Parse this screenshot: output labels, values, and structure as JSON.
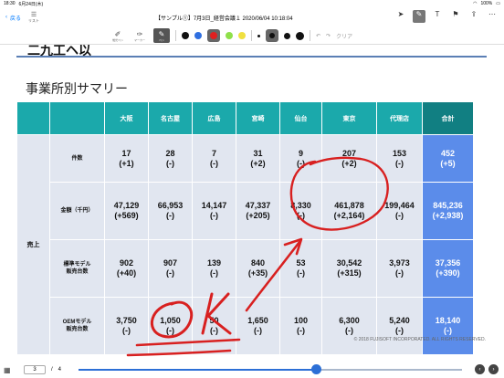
{
  "status": {
    "time": "18:30",
    "date": "6月24日(木)",
    "battery": "100%"
  },
  "nav": {
    "back_label": "戻る",
    "list_label": "リスト",
    "title": "【サンプル①】7月3日_経営会議１ 2020/06/04 10:18:04"
  },
  "toolbar": {
    "highlighter_label": "蛍光ペン",
    "marker_label": "マーカー",
    "pen_label": "ペン",
    "clear_label": "クリア",
    "colors": [
      "#111111",
      "#2f6fe0",
      "#e02020",
      "#8fe04a",
      "#f0e040"
    ]
  },
  "page": {
    "header_text": "二九工ヘ以",
    "subtitle": "事業所別サマリー",
    "copyright": "© 2018 FUJISOFT INCORPORATED. ALL RIGHTS RESERVED."
  },
  "table": {
    "headers": [
      "大阪",
      "名古屋",
      "広島",
      "宮崎",
      "仙台",
      "東京",
      "代理店",
      "合計"
    ],
    "group_label": "売上",
    "rows": [
      {
        "label": "件数",
        "cells": [
          [
            "17",
            "(+1)"
          ],
          [
            "28",
            "(-)"
          ],
          [
            "7",
            "(-)"
          ],
          [
            "31",
            "(+2)"
          ],
          [
            "9",
            "(-)"
          ],
          [
            "207",
            "(+2)"
          ],
          [
            "153",
            "(-)"
          ],
          [
            "452",
            "(+5)"
          ]
        ]
      },
      {
        "label": "金額（千円）",
        "cells": [
          [
            "47,129",
            "(+569)"
          ],
          [
            "66,953",
            "(-)"
          ],
          [
            "14,147",
            "(-)"
          ],
          [
            "47,337",
            "(+205)"
          ],
          [
            "8,330",
            "(-)"
          ],
          [
            "461,878",
            "(+2,164)"
          ],
          [
            "199,464",
            "(-)"
          ],
          [
            "845,236",
            "(+2,938)"
          ]
        ]
      },
      {
        "label": "標準モデル\n販売台数",
        "cells": [
          [
            "902",
            "(+40)"
          ],
          [
            "907",
            "(-)"
          ],
          [
            "139",
            "(-)"
          ],
          [
            "840",
            "(+35)"
          ],
          [
            "53",
            "(-)"
          ],
          [
            "30,542",
            "(+315)"
          ],
          [
            "3,973",
            "(-)"
          ],
          [
            "37,356",
            "(+390)"
          ]
        ]
      },
      {
        "label": "OEMモデル\n販売台数",
        "cells": [
          [
            "3,750",
            "(-)"
          ],
          [
            "1,050",
            "(-)"
          ],
          [
            "50",
            "(-)"
          ],
          [
            "1,650",
            "(-)"
          ],
          [
            "100",
            "(-)"
          ],
          [
            "6,300",
            "(-)"
          ],
          [
            "5,240",
            "(-)"
          ],
          [
            "18,140",
            "(-)"
          ]
        ]
      }
    ]
  },
  "pager": {
    "current": "3",
    "separator": "/",
    "total": "4",
    "progress": 0.62
  },
  "ink": {
    "text": "OK",
    "color": "#d82020"
  }
}
